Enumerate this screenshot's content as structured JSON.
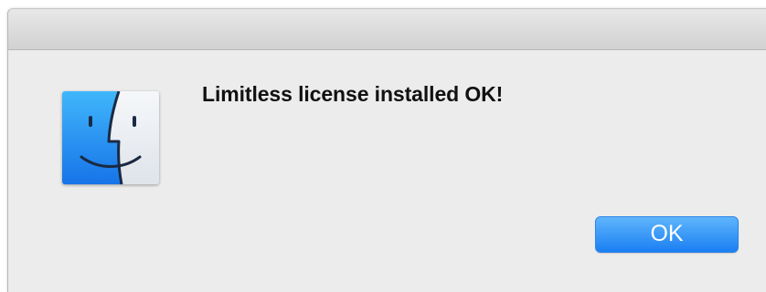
{
  "dialog": {
    "message": "Limitless license installed OK!",
    "icon": "finder-icon",
    "ok_label": "OK"
  },
  "colors": {
    "button": "#2a8af5",
    "background": "#ececec",
    "icon_blue": "#1f8cf0",
    "icon_light": "#eef1f5"
  }
}
